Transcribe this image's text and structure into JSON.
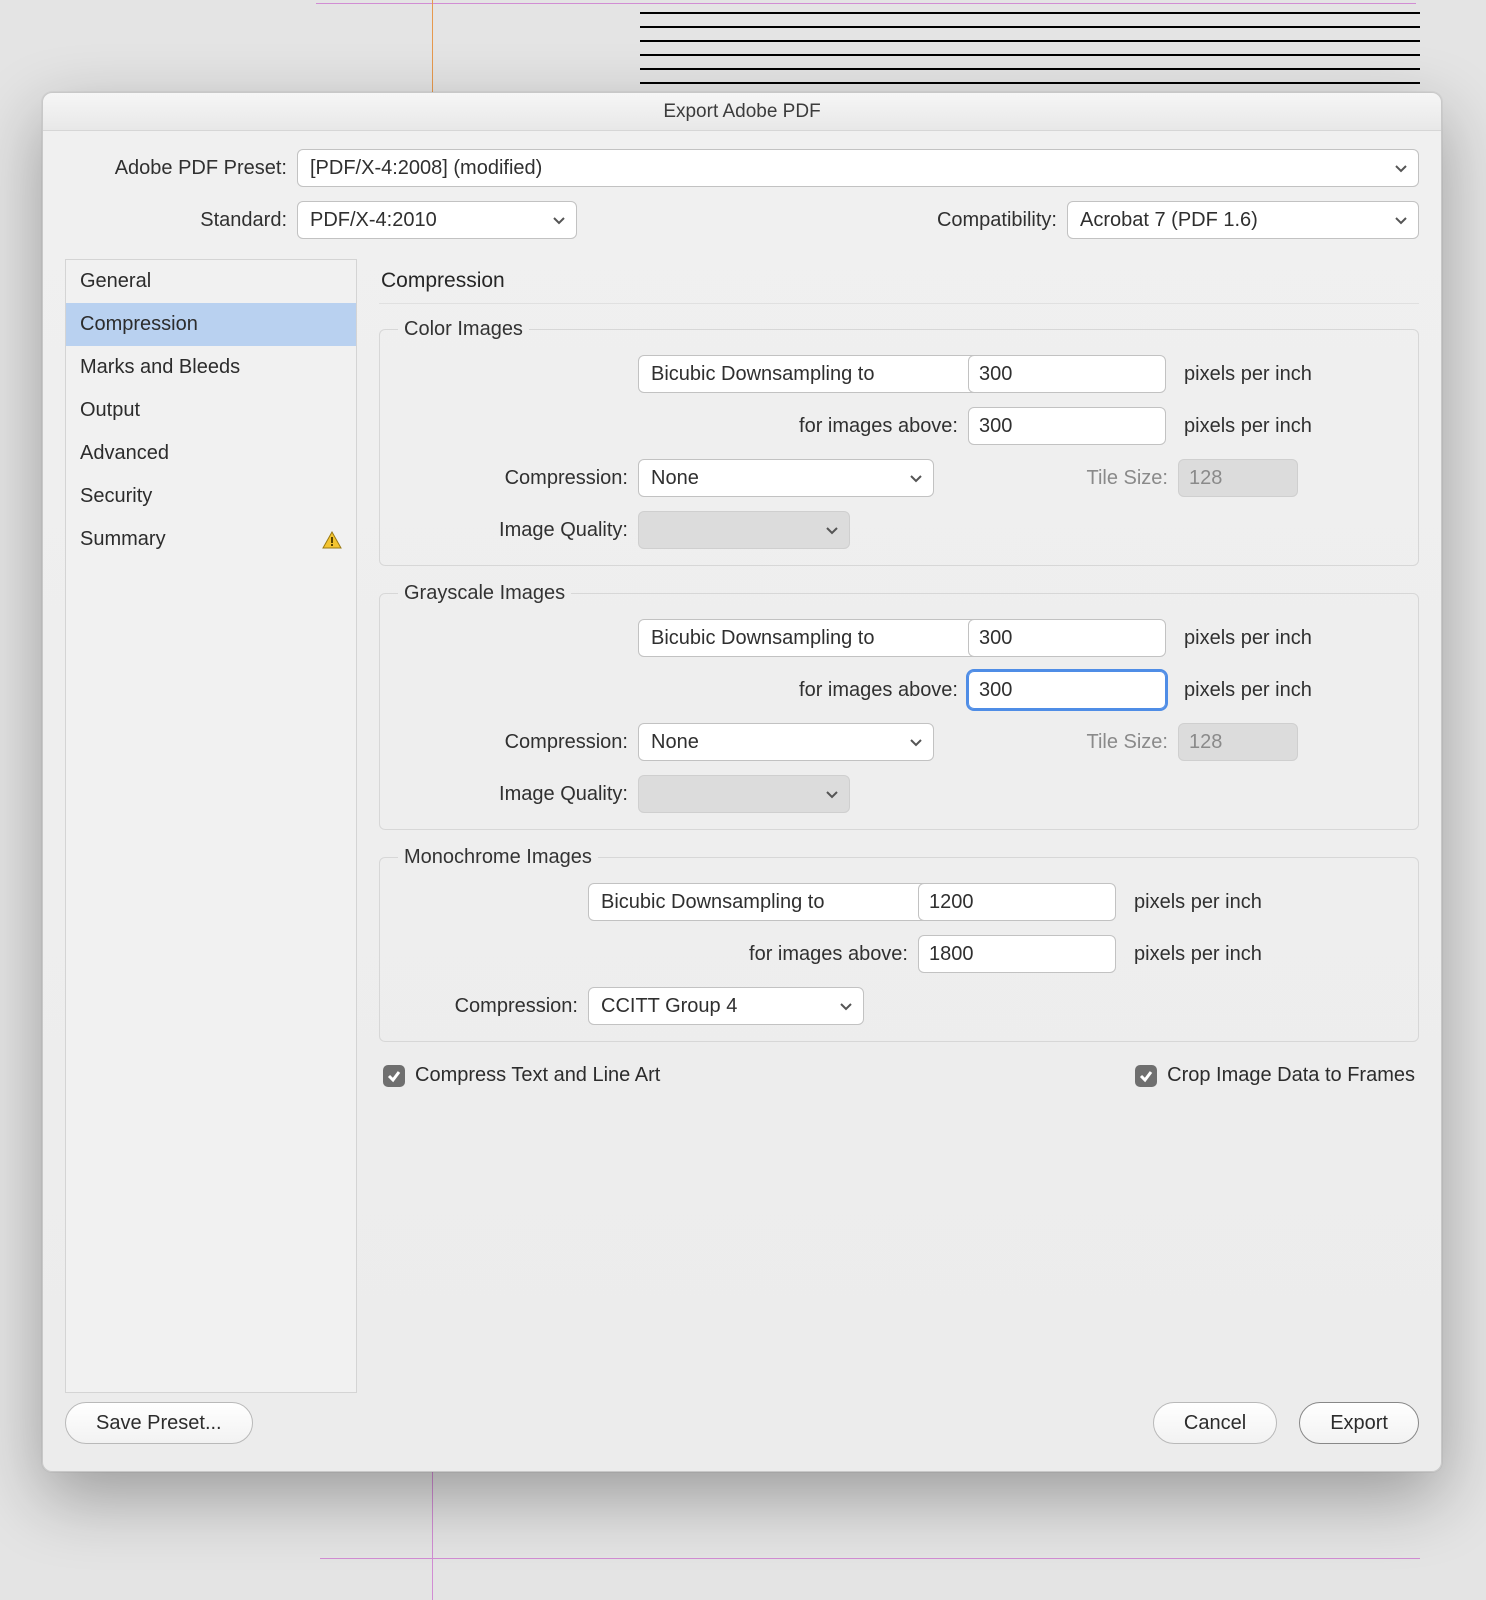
{
  "dialog": {
    "title": "Export Adobe PDF",
    "preset_label": "Adobe PDF Preset:",
    "preset_value": "[PDF/X-4:2008] (modified)",
    "standard_label": "Standard:",
    "standard_value": "PDF/X-4:2010",
    "compat_label": "Compatibility:",
    "compat_value": "Acrobat 7 (PDF 1.6)"
  },
  "sidebar": {
    "items": [
      {
        "label": "General"
      },
      {
        "label": "Compression"
      },
      {
        "label": "Marks and Bleeds"
      },
      {
        "label": "Output"
      },
      {
        "label": "Advanced"
      },
      {
        "label": "Security"
      },
      {
        "label": "Summary"
      }
    ]
  },
  "content": {
    "heading": "Compression",
    "color": {
      "legend": "Color Images",
      "downsample": "Bicubic Downsampling to",
      "ppi": "300",
      "above_label": "for images above:",
      "above": "300",
      "unit": "pixels per inch",
      "compression_label": "Compression:",
      "compression": "None",
      "tile_label": "Tile Size:",
      "tile": "128",
      "quality_label": "Image Quality:",
      "quality": ""
    },
    "gray": {
      "legend": "Grayscale Images",
      "downsample": "Bicubic Downsampling to",
      "ppi": "300",
      "above_label": "for images above:",
      "above": "300",
      "unit": "pixels per inch",
      "compression_label": "Compression:",
      "compression": "None",
      "tile_label": "Tile Size:",
      "tile": "128",
      "quality_label": "Image Quality:",
      "quality": ""
    },
    "mono": {
      "legend": "Monochrome Images",
      "downsample": "Bicubic Downsampling to",
      "ppi": "1200",
      "above_label": "for images above:",
      "above": "1800",
      "unit": "pixels per inch",
      "compression_label": "Compression:",
      "compression": "CCITT Group 4"
    },
    "chk_compress": "Compress Text and Line Art",
    "chk_crop": "Crop Image Data to Frames"
  },
  "footer": {
    "save_preset": "Save Preset...",
    "cancel": "Cancel",
    "export": "Export"
  }
}
